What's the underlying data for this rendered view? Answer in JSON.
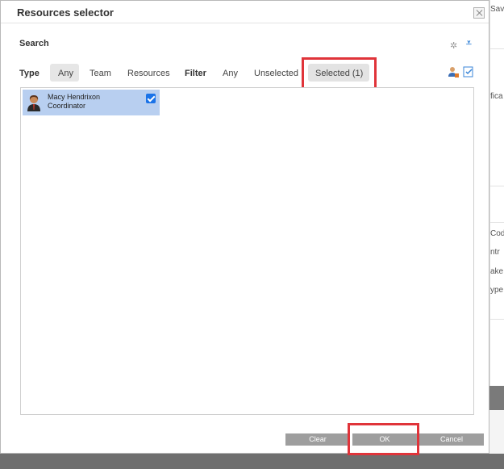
{
  "dialog": {
    "title": "Resources selector",
    "search_label": "Search"
  },
  "filters": {
    "type_label": "Type",
    "type_options": [
      "Any",
      "Team",
      "Resources"
    ],
    "filter_label": "Filter",
    "filter_options": [
      "Any",
      "Unselected",
      "Selected (1)"
    ],
    "active_type": "Any",
    "active_filter": "Selected (1)"
  },
  "resources": [
    {
      "name": "Macy Hendrixon",
      "role": "Coordinator",
      "selected": true
    }
  ],
  "buttons": {
    "clear": "Clear",
    "ok": "OK",
    "cancel": "Cancel"
  },
  "background": {
    "fragments": [
      "Savi",
      "fica",
      "Cod",
      "ntr",
      "ake",
      "ype"
    ]
  },
  "colors": {
    "highlight": "#e0343a",
    "selected_row": "#b8cff0",
    "checkbox": "#1a73e8",
    "button": "#9e9e9e"
  },
  "icons": [
    "close-icon",
    "refresh-icon",
    "expand-icon",
    "user-add-icon",
    "check-doc-icon",
    "avatar-icon",
    "checkbox-icon"
  ]
}
